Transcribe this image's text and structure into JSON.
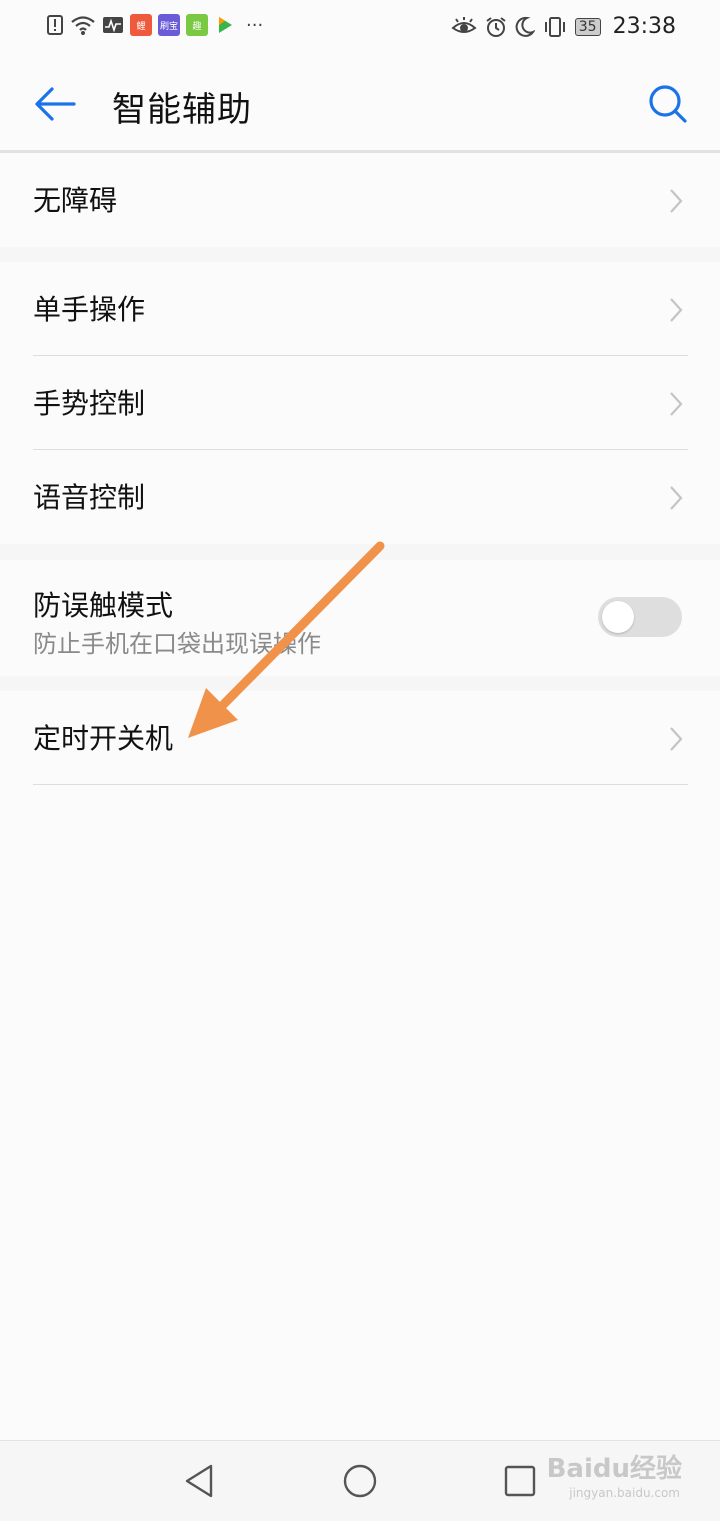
{
  "status_bar": {
    "time": "23:38",
    "battery": "35",
    "app_badges": [
      {
        "label": "鲤",
        "color": "#f05a3c"
      },
      {
        "label": "刷宝",
        "color": "#6a5cd8"
      },
      {
        "label": "趣",
        "color": "#7ac943"
      },
      {
        "label": "",
        "color": "#ffffff"
      }
    ],
    "more": "···"
  },
  "app_bar": {
    "title": "智能辅助",
    "accent": "#1a73e8"
  },
  "groups": [
    {
      "items": [
        {
          "label": "无障碍"
        }
      ]
    },
    {
      "items": [
        {
          "label": "单手操作"
        },
        {
          "label": "手势控制"
        },
        {
          "label": "语音控制"
        }
      ]
    },
    {
      "items": [
        {
          "label": "防误触模式",
          "sublabel": "防止手机在口袋出现误操作",
          "toggle": false
        }
      ]
    },
    {
      "items": [
        {
          "label": "定时开关机"
        }
      ]
    }
  ],
  "overlay": {
    "arrow_color": "#f0924a"
  },
  "watermark": {
    "text": "Baidu经验",
    "sub": "jingyan.baidu.com"
  }
}
